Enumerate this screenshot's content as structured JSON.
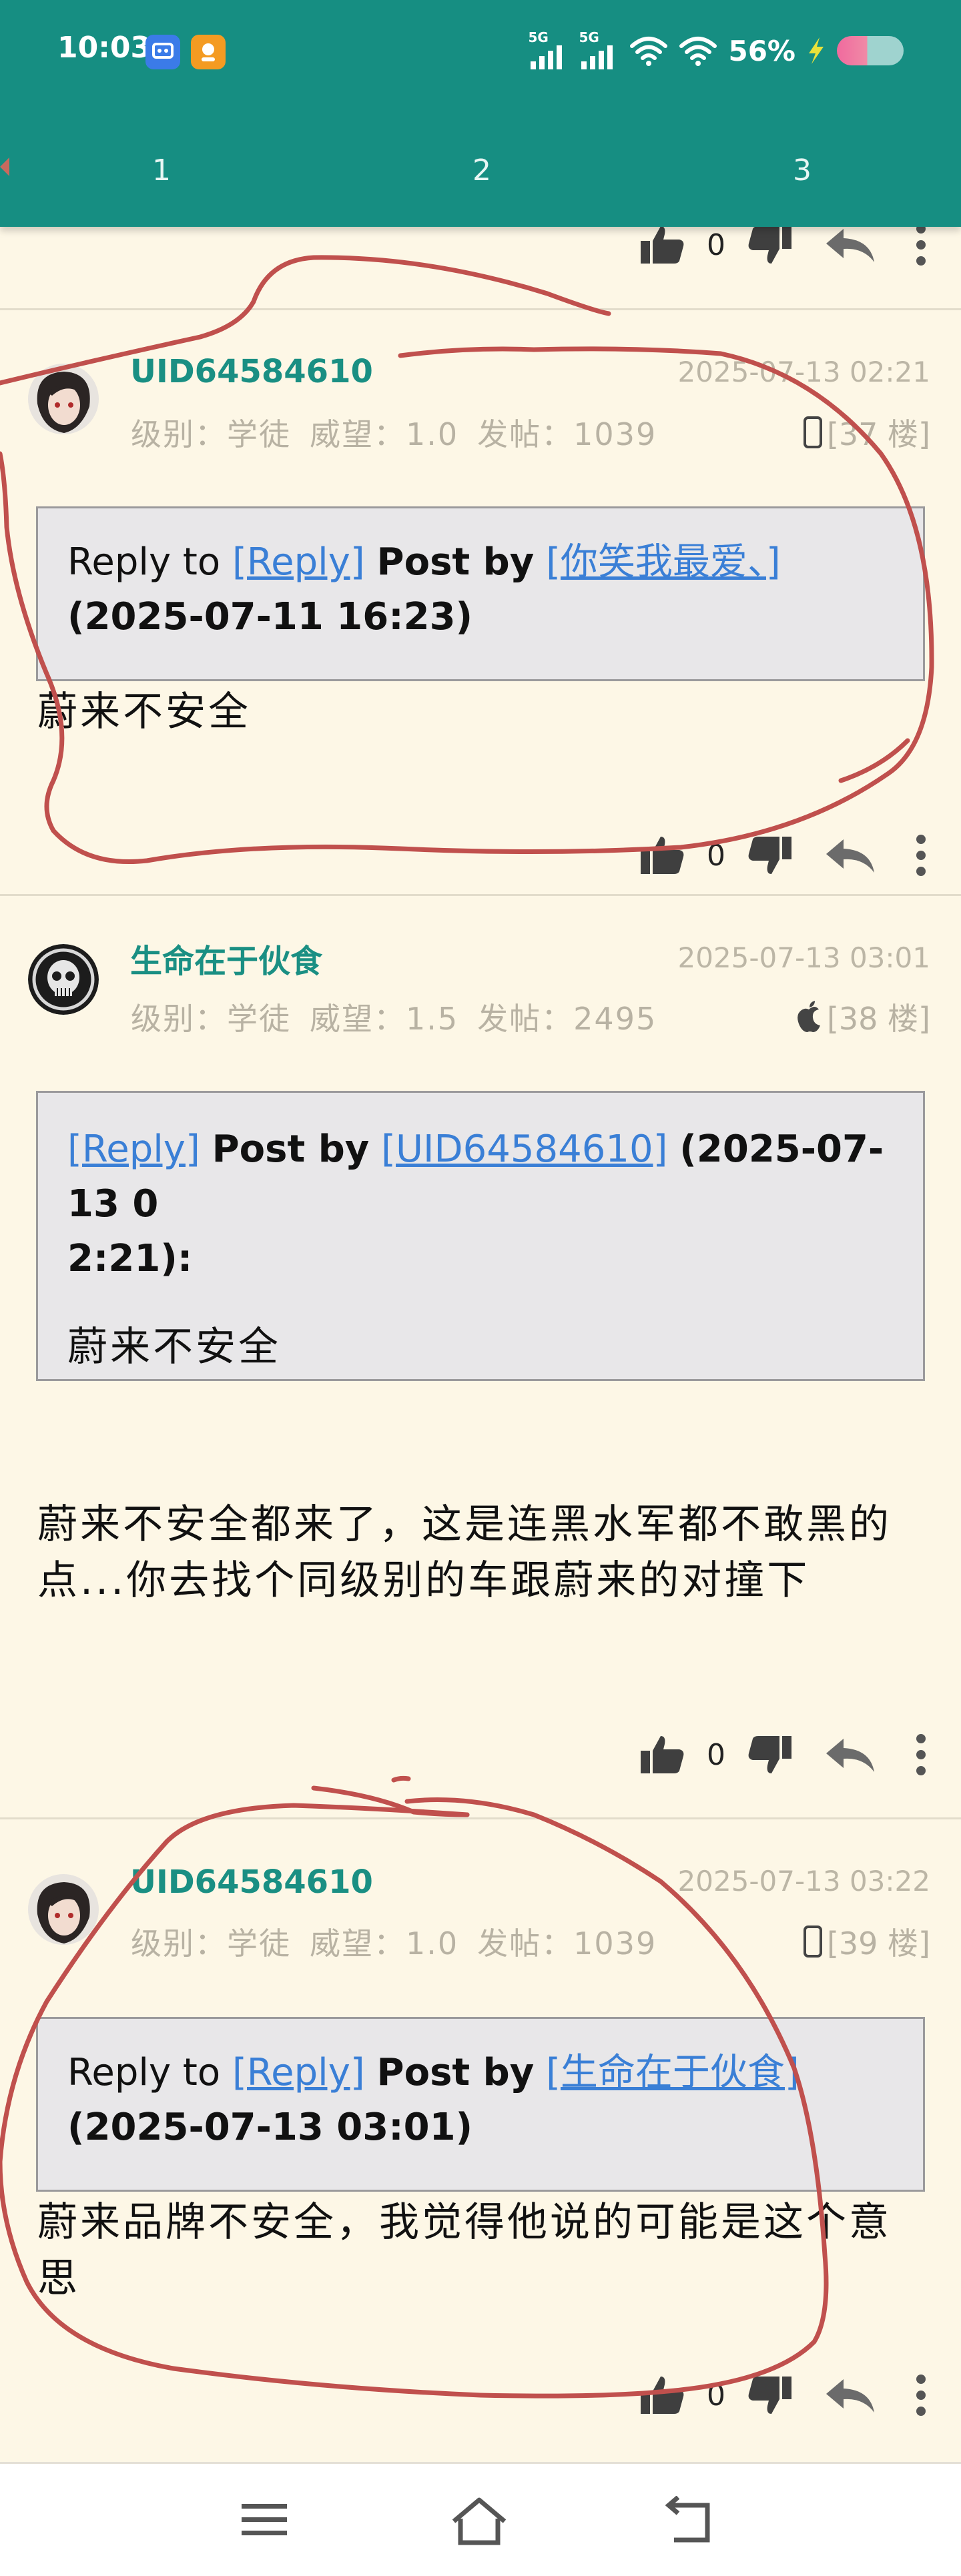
{
  "status_bar": {
    "time": "10:03",
    "signal_1": "5G",
    "signal_2": "5G",
    "battery": "56%",
    "icons": [
      "notification-app-icon",
      "taobao-app-icon",
      "signal-icon",
      "wifi-icon",
      "charging-icon",
      "battery-icon"
    ]
  },
  "tabs": [
    "1",
    "2",
    "3"
  ],
  "top_actions": {
    "likes": "0"
  },
  "posts": [
    {
      "username": "UID64584610",
      "time": "2025-07-13 02:21",
      "level": "级别：学徒",
      "prestige": "威望：1.0",
      "post_count": "发帖：1039",
      "device_icon": "phone-icon",
      "floor": "[37 楼]",
      "quote": {
        "prefix": "Reply to",
        "link1": "[Reply]",
        "mid": "Post by",
        "link2": "[你笑我最爱、]",
        "time": "(2025-07-11 16:23)"
      },
      "body": "蔚来不安全",
      "likes": "0"
    },
    {
      "username": "生命在于伙食",
      "time": "2025-07-13 03:01",
      "level": "级别：学徒",
      "prestige": "威望：1.5",
      "post_count": "发帖：2495",
      "device_icon": "apple-icon",
      "floor": "[38 楼]",
      "quote": {
        "link1": "[Reply]",
        "mid": "Post by",
        "link2": "[UID64584610]",
        "time": "(2025-07-13 0",
        "time2": "2:21):",
        "quoted_text": "蔚来不安全"
      },
      "body": "蔚来不安全都来了，这是连黑水军都不敢黑的点...你去找个同级别的车跟蔚来的对撞下",
      "likes": "0"
    },
    {
      "username": "UID64584610",
      "time": "2025-07-13 03:22",
      "level": "级别：学徒",
      "prestige": "威望：1.0",
      "post_count": "发帖：1039",
      "device_icon": "phone-icon",
      "floor": "[39 楼]",
      "quote": {
        "prefix": "Reply to",
        "link1": "[Reply]",
        "mid": "Post by",
        "link2": "[生命在于伙食]",
        "time": "(2025-07-13 03:01)"
      },
      "body": "蔚来品牌不安全，我觉得他说的可能是这个意思",
      "likes": "0"
    }
  ],
  "nav": {
    "icons": [
      "menu-icon",
      "home-icon",
      "back-icon"
    ]
  },
  "colors": {
    "header": "#168e82",
    "background": "#fdf7e6",
    "link": "#3a7fd6",
    "username": "#1a8f83",
    "annotation": "#c0504d"
  }
}
